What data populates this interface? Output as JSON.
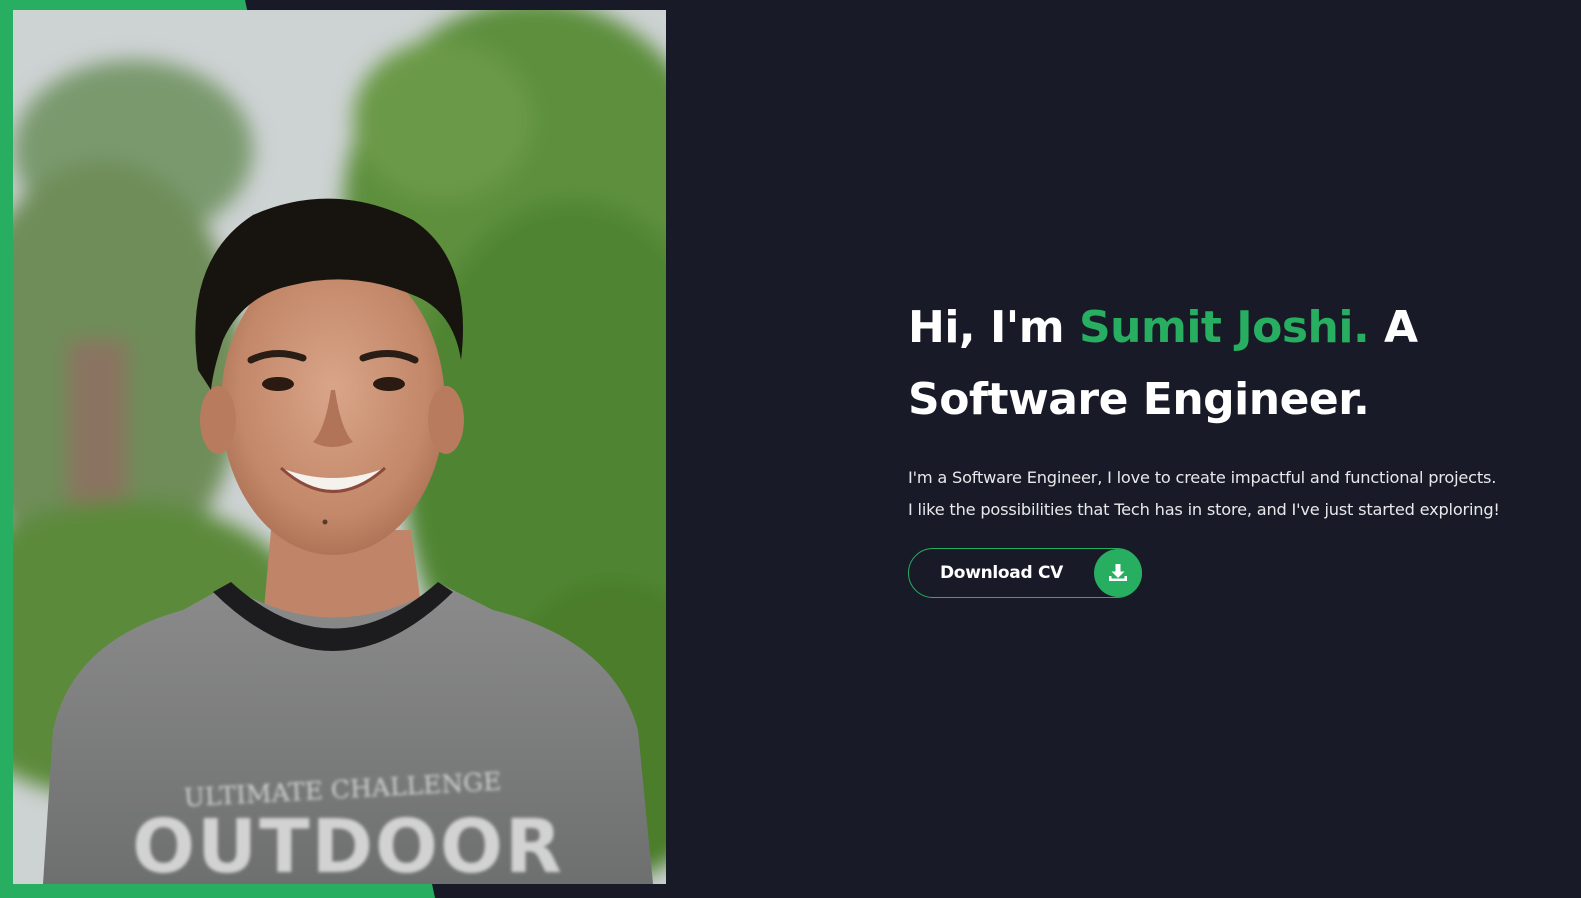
{
  "hero": {
    "greeting": "Hi, I'm",
    "name": "Sumit Joshi.",
    "role_article": "A",
    "role": "Software Engineer.",
    "bio_line1": "I'm a Software Engineer, I love to create impactful and functional projects.",
    "bio_line2": "I like the possibilities that Tech has in store, and I've just started exploring!",
    "cv_button_label": "Download CV",
    "cv_button_icon": "download-icon"
  },
  "profile_photo": {
    "shirt_line1": "ULTIMATE CHALLENGE",
    "shirt_line2": "OUTDOOR"
  },
  "colors": {
    "accent": "#27ae60",
    "background": "#181b27",
    "text": "#ffffff"
  }
}
